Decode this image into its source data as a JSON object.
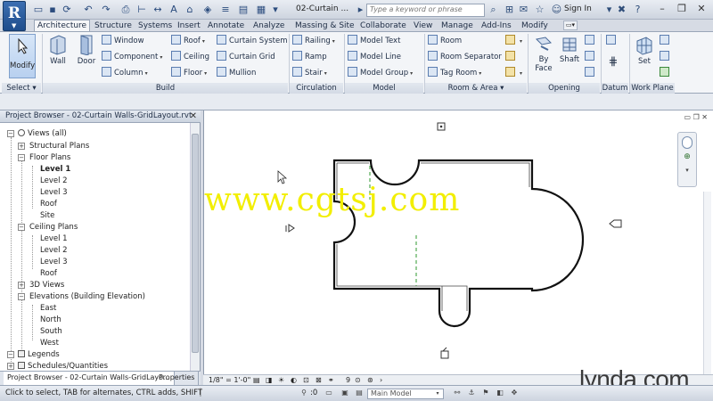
{
  "titlebar": {
    "app_button": "R",
    "doc_title": "02-Curtain ...",
    "search_placeholder": "Type a keyword or phrase",
    "sign_in": "Sign In"
  },
  "tabs": [
    "Architecture",
    "Structure",
    "Systems",
    "Insert",
    "Annotate",
    "Analyze",
    "Massing & Site",
    "Collaborate",
    "View",
    "Manage",
    "Add-Ins",
    "Modify"
  ],
  "ribbon": {
    "select": {
      "modify": "Modify",
      "panel": "Select"
    },
    "build": {
      "wall": "Wall",
      "door": "Door",
      "window": "Window",
      "component": "Component",
      "column": "Column",
      "roof": "Roof",
      "ceiling": "Ceiling",
      "floor": "Floor",
      "curtain_system": "Curtain System",
      "curtain_grid": "Curtain Grid",
      "mullion": "Mullion",
      "panel": "Build"
    },
    "circulation": {
      "railing": "Railing",
      "ramp": "Ramp",
      "stair": "Stair",
      "panel": "Circulation"
    },
    "model": {
      "model_text": "Model Text",
      "model_line": "Model Line",
      "model_group": "Model Group",
      "panel": "Model"
    },
    "room_area": {
      "room": "Room",
      "room_separator": "Room Separator",
      "tag_room": "Tag Room",
      "panel": "Room & Area"
    },
    "opening": {
      "by_face_1": "By",
      "by_face_2": "Face",
      "shaft": "Shaft",
      "panel": "Opening"
    },
    "datum": {
      "panel": "Datum"
    },
    "work_plane": {
      "set": "Set",
      "panel": "Work Plane"
    }
  },
  "project_browser": {
    "title": "Project Browser - 02-Curtain Walls-GridLayout.rvt",
    "tree": [
      {
        "label": "Views (all)",
        "level": 0
      },
      {
        "label": "Structural Plans",
        "level": 1
      },
      {
        "label": "Floor Plans",
        "level": 1
      },
      {
        "label": "Level 1",
        "level": 2,
        "bold": true
      },
      {
        "label": "Level 2",
        "level": 2
      },
      {
        "label": "Level 3",
        "level": 2
      },
      {
        "label": "Roof",
        "level": 2
      },
      {
        "label": "Site",
        "level": 2
      },
      {
        "label": "Ceiling Plans",
        "level": 1
      },
      {
        "label": "Level 1",
        "level": 2
      },
      {
        "label": "Level 2",
        "level": 2
      },
      {
        "label": "Level 3",
        "level": 2
      },
      {
        "label": "Roof",
        "level": 2
      },
      {
        "label": "3D Views",
        "level": 1
      },
      {
        "label": "Elevations (Building Elevation)",
        "level": 1
      },
      {
        "label": "East",
        "level": 2
      },
      {
        "label": "North",
        "level": 2
      },
      {
        "label": "South",
        "level": 2
      },
      {
        "label": "West",
        "level": 2
      },
      {
        "label": "Legends",
        "level": 0
      },
      {
        "label": "Schedules/Quantities",
        "level": 0
      }
    ],
    "tabs": [
      "Project Browser - 02-Curtain Walls-GridLayo...",
      "Properties"
    ]
  },
  "view_controls": {
    "scale": "1/8\" = 1'-0\"",
    "detail_count": "9"
  },
  "watermark": "www.cgtsj.com",
  "brand": "lynda.com",
  "status": {
    "text": "Click to select, TAB for alternates, CTRL adds, SHIFT",
    "zero": ":0",
    "model": "Main Model"
  }
}
